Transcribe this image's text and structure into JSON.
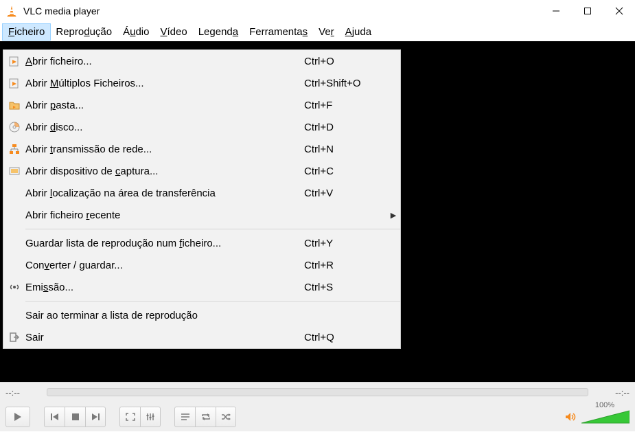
{
  "titlebar": {
    "title": "VLC media player"
  },
  "menubar": {
    "items": [
      {
        "pre": "",
        "ul": "F",
        "post": "icheiro",
        "selected": true
      },
      {
        "pre": "Repro",
        "ul": "d",
        "post": "ução",
        "selected": false
      },
      {
        "pre": "Á",
        "ul": "u",
        "post": "dio",
        "selected": false
      },
      {
        "pre": "",
        "ul": "V",
        "post": "ídeo",
        "selected": false
      },
      {
        "pre": "Legend",
        "ul": "a",
        "post": "",
        "selected": false
      },
      {
        "pre": "Ferramenta",
        "ul": "s",
        "post": "",
        "selected": false
      },
      {
        "pre": "Ve",
        "ul": "r",
        "post": "",
        "selected": false
      },
      {
        "pre": "",
        "ul": "A",
        "post": "juda",
        "selected": false
      }
    ]
  },
  "dropdown": {
    "items": [
      {
        "type": "item",
        "icon": "play-file",
        "pre": "",
        "ul": "A",
        "post": "brir ficheiro...",
        "short": "Ctrl+O"
      },
      {
        "type": "item",
        "icon": "play-file",
        "pre": "Abrir ",
        "ul": "M",
        "post": "últiplos Ficheiros...",
        "short": "Ctrl+Shift+O"
      },
      {
        "type": "item",
        "icon": "folder",
        "pre": "Abrir ",
        "ul": "p",
        "post": "asta...",
        "short": "Ctrl+F"
      },
      {
        "type": "item",
        "icon": "disc",
        "pre": "Abrir ",
        "ul": "d",
        "post": "isco...",
        "short": "Ctrl+D"
      },
      {
        "type": "item",
        "icon": "network",
        "pre": "Abrir ",
        "ul": "t",
        "post": "ransmissão de rede...",
        "short": "Ctrl+N"
      },
      {
        "type": "item",
        "icon": "capture",
        "pre": "Abrir dispositivo de ",
        "ul": "c",
        "post": "aptura...",
        "short": "Ctrl+C"
      },
      {
        "type": "item",
        "icon": "",
        "pre": "Abrir ",
        "ul": "l",
        "post": "ocalização na área de transferência",
        "short": "Ctrl+V"
      },
      {
        "type": "submenu",
        "icon": "",
        "pre": "Abrir ficheiro ",
        "ul": "r",
        "post": "ecente",
        "short": ""
      },
      {
        "type": "sep"
      },
      {
        "type": "item",
        "icon": "",
        "pre": "Guardar lista de reprodução num ",
        "ul": "f",
        "post": "icheiro...",
        "short": "Ctrl+Y"
      },
      {
        "type": "item",
        "icon": "",
        "pre": "Con",
        "ul": "v",
        "post": "erter / guardar...",
        "short": "Ctrl+R"
      },
      {
        "type": "item",
        "icon": "stream",
        "pre": "Emi",
        "ul": "s",
        "post": "são...",
        "short": "Ctrl+S"
      },
      {
        "type": "sep"
      },
      {
        "type": "item",
        "icon": "",
        "pre": "Sair ao terminar a lista de reprodução",
        "ul": "",
        "post": "",
        "short": ""
      },
      {
        "type": "item",
        "icon": "exit",
        "pre": "Sair",
        "ul": "",
        "post": "",
        "short": "Ctrl+Q"
      }
    ]
  },
  "time": {
    "left": "--:--",
    "right": "--:--"
  },
  "volume": {
    "percent": "100%"
  }
}
